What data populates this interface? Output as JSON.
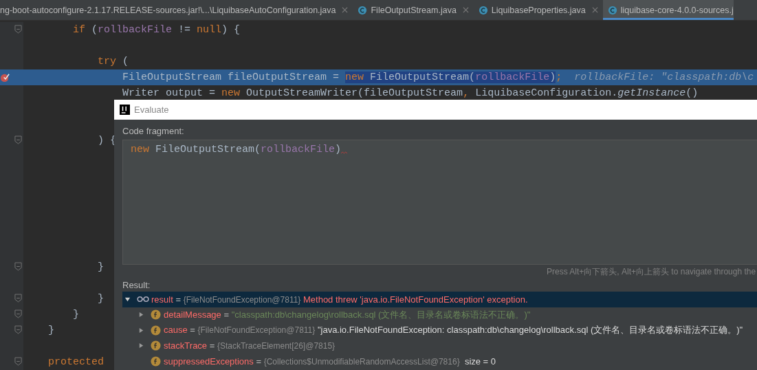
{
  "tabs": [
    {
      "label": "ng-boot-autoconfigure-2.1.17.RELEASE-sources.jar!\\...\\LiquibaseAutoConfiguration.java",
      "icon": false,
      "closable": true,
      "selected": false
    },
    {
      "label": "FileOutputStream.java",
      "icon": true,
      "closable": true,
      "selected": false
    },
    {
      "label": "LiquibaseProperties.java",
      "icon": true,
      "closable": true,
      "selected": false
    },
    {
      "label": "liquibase-core-4.0.0-sources.j",
      "icon": true,
      "closable": false,
      "selected": true
    }
  ],
  "editor": {
    "lines": [
      {
        "fold_marker": true,
        "breakpoint": false,
        "highlighted": false,
        "tokens": [
          {
            "text": "        if",
            "kind": "keyword"
          },
          {
            "text": " (",
            "kind": "plain"
          },
          {
            "text": "rollbackFile",
            "kind": "param"
          },
          {
            "text": " != ",
            "kind": "plain"
          },
          {
            "text": "null",
            "kind": "keyword"
          },
          {
            "text": ") {",
            "kind": "plain"
          }
        ]
      },
      {
        "fold_marker": false,
        "breakpoint": false,
        "highlighted": false
      },
      {
        "fold_marker": false,
        "breakpoint": false,
        "highlighted": false,
        "tokens": [
          {
            "text": "            try",
            "kind": "keyword"
          },
          {
            "text": " (",
            "kind": "plain"
          }
        ]
      },
      {
        "fold_marker": false,
        "breakpoint": true,
        "highlighted": true,
        "tokens": [
          {
            "text": "                FileOutputStream fileOutputStream = ",
            "kind": "plain",
            "selected": false
          },
          {
            "text": "new",
            "kind": "keyword",
            "selected": true
          },
          {
            "text": " FileOutputStream(",
            "kind": "plain",
            "selected": true
          },
          {
            "text": "rollbackFile",
            "kind": "param",
            "selected": true
          },
          {
            "text": ")",
            "kind": "plain",
            "selected": true
          },
          {
            "text": ";",
            "kind": "keyword",
            "selected": false
          }
        ],
        "hint": "rollbackFile: \"classpath:db\\c"
      },
      {
        "fold_marker": false,
        "breakpoint": false,
        "highlighted": false,
        "tokens": [
          {
            "text": "                Writer output = ",
            "kind": "plain"
          },
          {
            "text": "new",
            "kind": "keyword"
          },
          {
            "text": " OutputStreamWriter(fileOutputStream",
            "kind": "plain"
          },
          {
            "text": ",",
            "kind": "keyword"
          },
          {
            "text": " LiquibaseConfiguration.",
            "kind": "plain"
          },
          {
            "text": "getInstance",
            "kind": "italic"
          },
          {
            "text": "()",
            "kind": "plain"
          }
        ]
      },
      {
        "fold_marker": false,
        "breakpoint": false,
        "highlighted": false
      },
      {
        "fold_marker": false,
        "breakpoint": false,
        "highlighted": false
      },
      {
        "fold_marker": true,
        "breakpoint": false,
        "highlighted": false,
        "tokens": [
          {
            "text": "            ) {",
            "kind": "plain"
          }
        ]
      },
      {
        "fold_marker": false,
        "breakpoint": false,
        "highlighted": false
      },
      {
        "fold_marker": false,
        "breakpoint": false,
        "highlighted": false
      },
      {
        "fold_marker": false,
        "breakpoint": false,
        "highlighted": false
      },
      {
        "fold_marker": false,
        "breakpoint": false,
        "highlighted": false
      },
      {
        "fold_marker": false,
        "breakpoint": false,
        "highlighted": false
      },
      {
        "fold_marker": false,
        "breakpoint": false,
        "highlighted": false
      },
      {
        "fold_marker": false,
        "breakpoint": false,
        "highlighted": false
      },
      {
        "fold_marker": true,
        "breakpoint": false,
        "highlighted": false,
        "tokens": [
          {
            "text": "            }",
            "kind": "plain"
          }
        ]
      },
      {
        "fold_marker": false,
        "breakpoint": false,
        "highlighted": false
      },
      {
        "fold_marker": true,
        "breakpoint": false,
        "highlighted": false,
        "tokens": [
          {
            "text": "            }",
            "kind": "plain"
          }
        ]
      },
      {
        "fold_marker": true,
        "breakpoint": false,
        "highlighted": false,
        "tokens": [
          {
            "text": "        }",
            "kind": "plain"
          }
        ]
      },
      {
        "fold_marker": true,
        "breakpoint": false,
        "highlighted": false,
        "tokens": [
          {
            "text": "    }",
            "kind": "plain"
          }
        ]
      },
      {
        "fold_marker": false,
        "breakpoint": false,
        "highlighted": false
      },
      {
        "fold_marker": true,
        "breakpoint": false,
        "highlighted": false,
        "tokens": [
          {
            "text": "    protected",
            "kind": "keyword"
          }
        ]
      }
    ]
  },
  "dialog": {
    "title": "Evaluate",
    "fragment_label": "Code fragment:",
    "fragment": [
      {
        "text": "new",
        "kind": "keyword"
      },
      {
        "text": " FileOutputStream(",
        "kind": "plain"
      },
      {
        "text": "rollbackFile",
        "kind": "param"
      },
      {
        "text": ")",
        "kind": "plain"
      }
    ],
    "fragment_error": true,
    "history_hint": "Press Alt+向下箭头, Alt+向上箭头 to navigate through the",
    "result_label": "Result:",
    "result": [
      {
        "kind": "watch",
        "expandable": true,
        "expanded": true,
        "selected": true,
        "parts": [
          {
            "text": "result",
            "kind": "name"
          },
          {
            "text": " = ",
            "kind": "eq"
          },
          {
            "text": "{FileNotFoundException@7811}",
            "kind": "ref"
          },
          {
            "text": " Method threw 'java.io.FileNotFoundException' exception.",
            "kind": "error"
          }
        ]
      },
      {
        "kind": "field",
        "expandable": true,
        "expanded": false,
        "selected": false,
        "parts": [
          {
            "text": "detailMessage",
            "kind": "name"
          },
          {
            "text": " = ",
            "kind": "eq"
          },
          {
            "text": "\"classpath:db\\changelog\\rollback.sql (文件名、目录名或卷标语法不正确。)\"",
            "kind": "string"
          }
        ]
      },
      {
        "kind": "field",
        "expandable": true,
        "expanded": false,
        "selected": false,
        "parts": [
          {
            "text": "cause",
            "kind": "name"
          },
          {
            "text": " = ",
            "kind": "eq"
          },
          {
            "text": "{FileNotFoundException@7811}",
            "kind": "ref"
          },
          {
            "text": " \"java.io.FileNotFoundException: classpath:db\\changelog\\rollback.sql (文件名、目录名或卷标语法不正确。)\"",
            "kind": "text"
          }
        ]
      },
      {
        "kind": "field",
        "expandable": true,
        "expanded": false,
        "selected": false,
        "parts": [
          {
            "text": "stackTrace",
            "kind": "name"
          },
          {
            "text": " = ",
            "kind": "eq"
          },
          {
            "text": "{StackTraceElement[26]@7815}",
            "kind": "ref"
          }
        ]
      },
      {
        "kind": "field",
        "expandable": false,
        "selected": false,
        "parts": [
          {
            "text": "suppressedExceptions",
            "kind": "name"
          },
          {
            "text": " = ",
            "kind": "eq"
          },
          {
            "text": "{Collections$UnmodifiableRandomAccessList@7816}",
            "kind": "ref"
          },
          {
            "text": "  size = 0",
            "kind": "text"
          }
        ]
      }
    ]
  }
}
